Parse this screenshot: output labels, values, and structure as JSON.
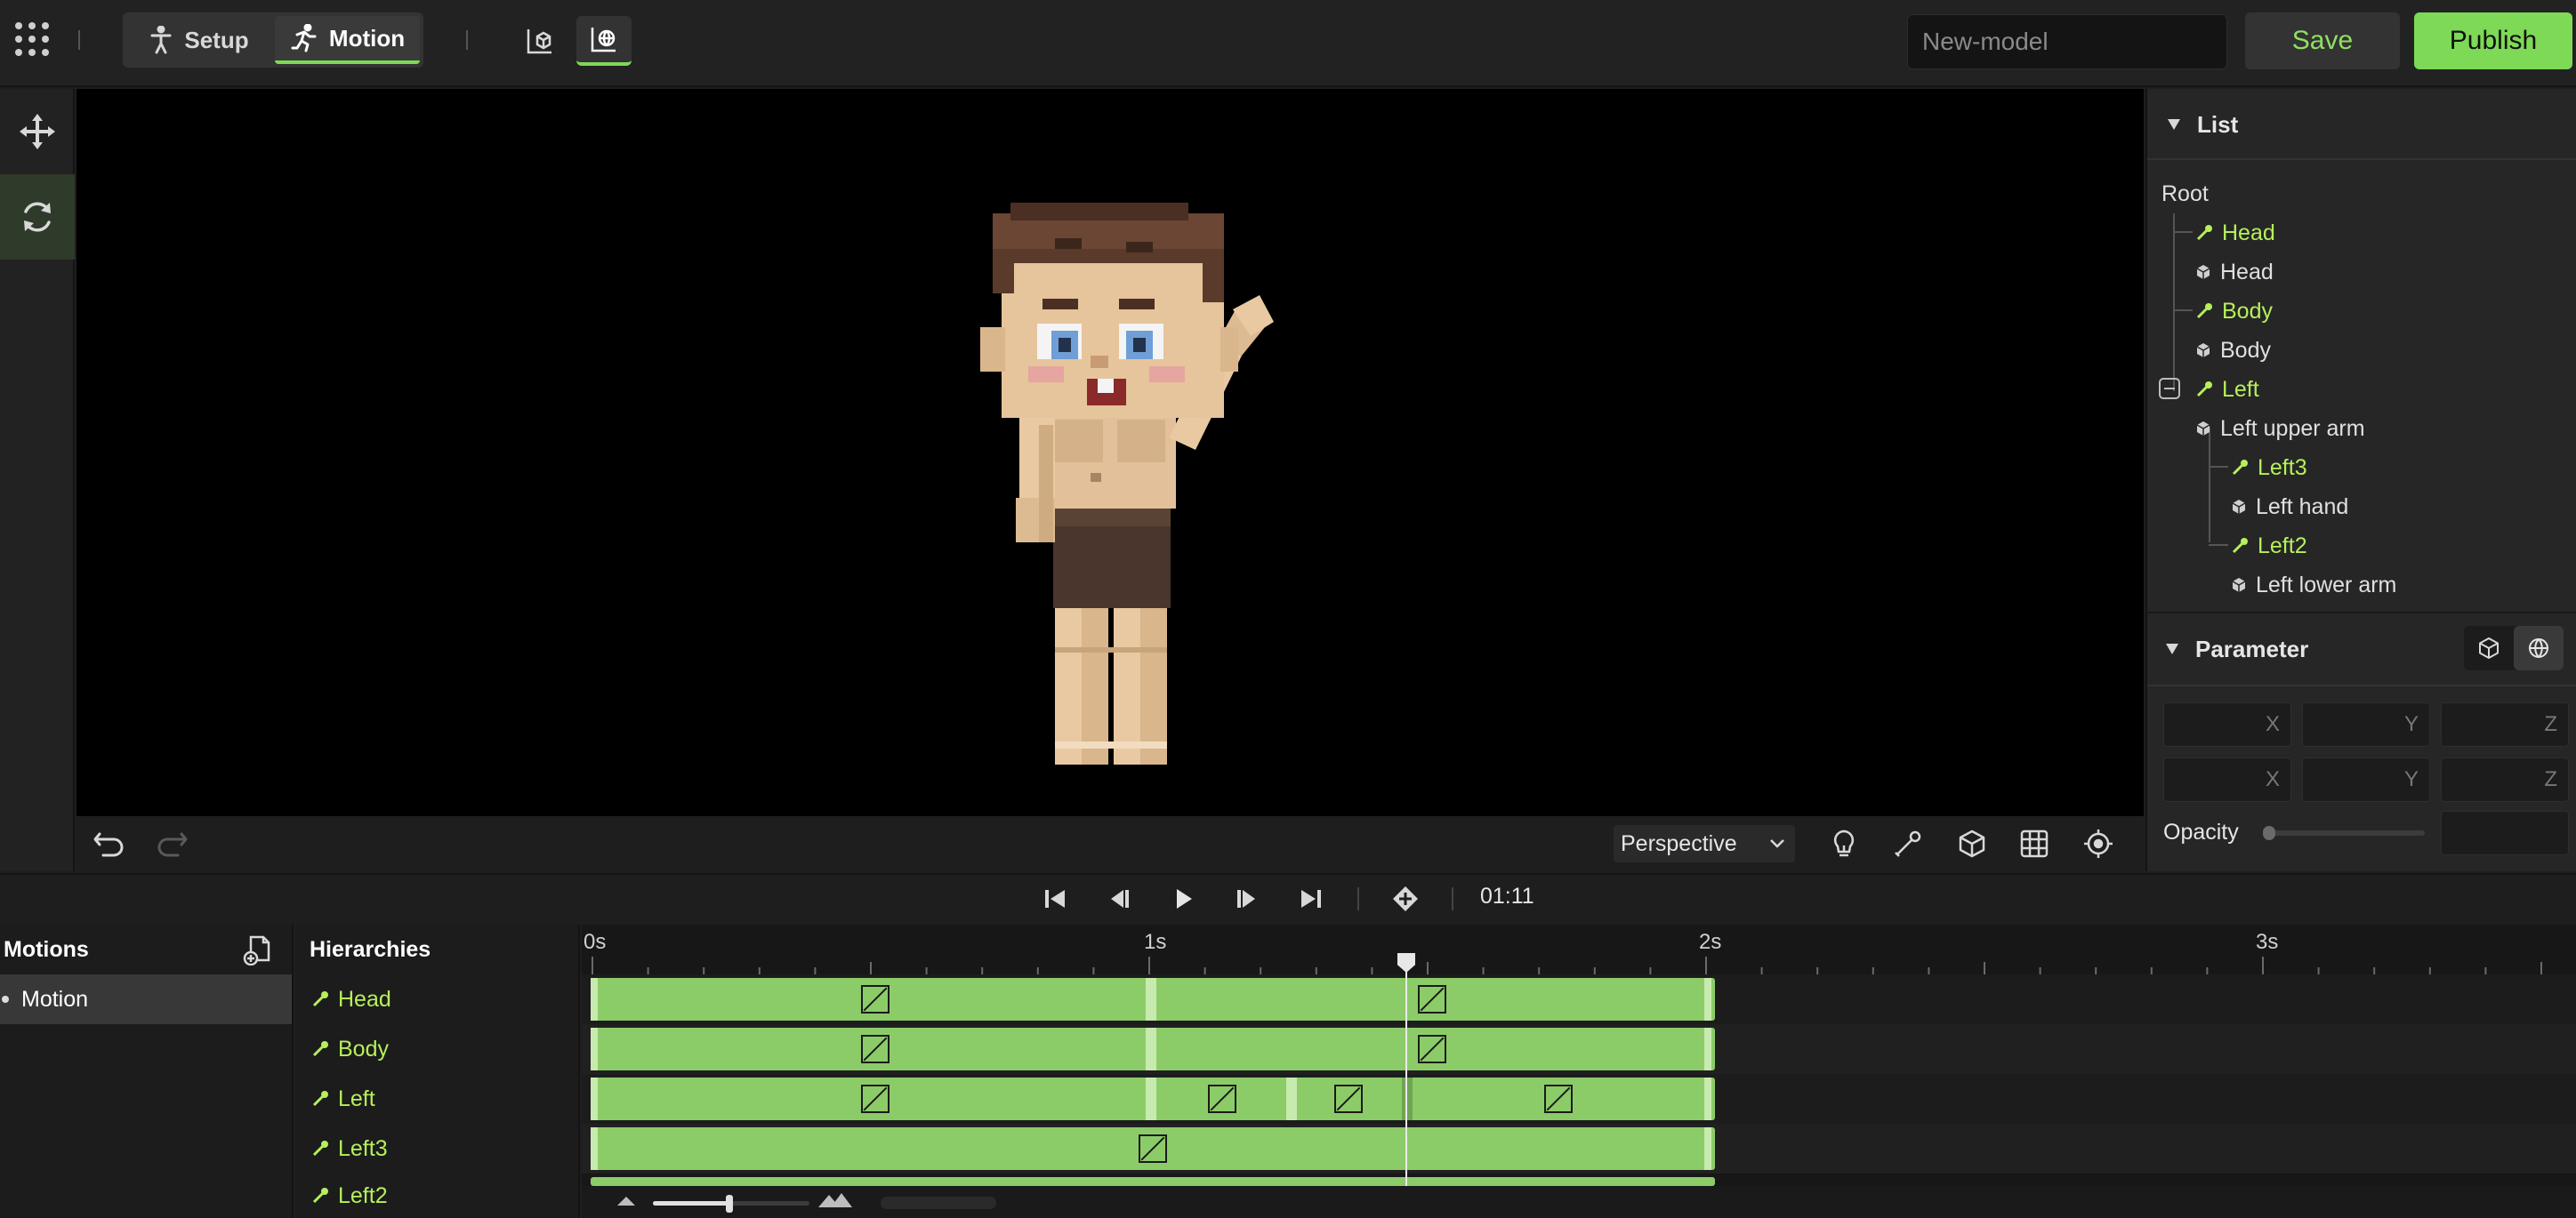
{
  "topbar": {
    "modes": [
      {
        "label": "Setup",
        "active": false
      },
      {
        "label": "Motion",
        "active": true
      }
    ],
    "model_name_placeholder": "New-model",
    "save_label": "Save",
    "publish_label": "Publish"
  },
  "viewport": {
    "camera": "Perspective"
  },
  "panel": {
    "list_title": "List",
    "root_label": "Root",
    "tree": [
      {
        "label": "Head",
        "kind": "bone"
      },
      {
        "label": "Head",
        "kind": "mesh"
      },
      {
        "label": "Body",
        "kind": "bone"
      },
      {
        "label": "Body",
        "kind": "mesh"
      },
      {
        "label": "Left",
        "kind": "bone"
      },
      {
        "label": "Left upper arm",
        "kind": "mesh"
      },
      {
        "label": "Left3",
        "kind": "bone"
      },
      {
        "label": "Left hand",
        "kind": "mesh"
      },
      {
        "label": "Left2",
        "kind": "bone"
      },
      {
        "label": "Left lower arm",
        "kind": "mesh"
      }
    ],
    "parameter_title": "Parameter",
    "axes": [
      "X",
      "Y",
      "Z"
    ],
    "opacity_label": "Opacity"
  },
  "transport": {
    "time": "01:11"
  },
  "timeline": {
    "motions_title": "Motions",
    "motions": [
      "Motion"
    ],
    "hierarchies_title": "Hierarchies",
    "rows": [
      "Head",
      "Body",
      "Left",
      "Left3",
      "Left2"
    ],
    "ruler": [
      "0s",
      "1s",
      "2s",
      "3s"
    ],
    "playhead_time": "01:11"
  },
  "colors": {
    "accent": "#7ed957",
    "bone_label": "#b6f05a",
    "clip": "#8ccc68"
  }
}
